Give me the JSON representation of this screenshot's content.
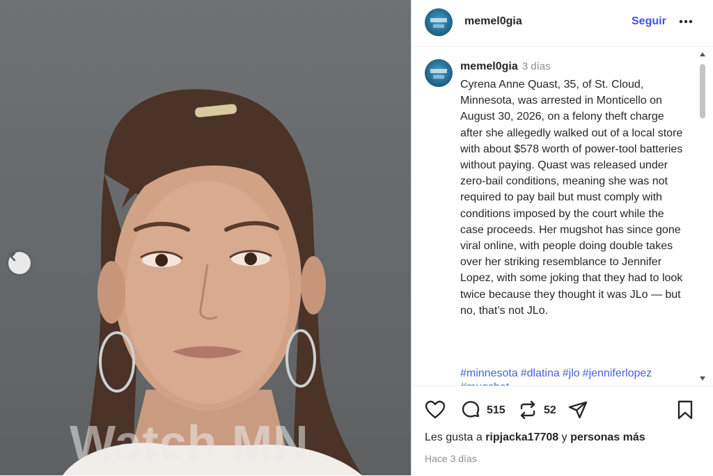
{
  "header": {
    "username": "memel0gia",
    "follow_label": "Seguir"
  },
  "caption": {
    "username": "memel0gia",
    "time": "3 días",
    "text": "Cyrena Anne Quast, 35, of St. Cloud, Minnesota, was arrested in Monticello on August 30, 2026, on a felony theft charge after she allegedly walked out of a local store with about $578 worth of power-tool batteries without paying. Quast was released under zero-bail conditions, meaning she was not required to pay bail but must comply with conditions imposed by the court while the case proceeds. Her mugshot has since gone viral online, with people doing double takes over her striking resemblance to Jennifer Lopez, with some joking that they had to look twice because they thought it was JLo — but no, that’s not JLo.",
    "hashtags": [
      "#minnesota",
      "#dlatina",
      "#jlo",
      "#jenniferlopez"
    ],
    "hashtags_clipped": "#mugshot"
  },
  "photo": {
    "watermark": "Watch MN"
  },
  "actions": {
    "comment_count": "515",
    "repost_count": "52"
  },
  "likes": {
    "prefix": "Les gusta a",
    "user": "ripjacka17708",
    "conj": "y",
    "others": "personas más"
  },
  "posted": "Hace 3 días",
  "icons": [
    "chevron-left-icon",
    "more-options-icon",
    "heart-icon",
    "comment-icon",
    "repost-icon",
    "share-icon",
    "bookmark-icon"
  ],
  "colors": {
    "follow": "#4150f7",
    "hashtag": "#485fe0",
    "muted": "#8e8e8e"
  }
}
